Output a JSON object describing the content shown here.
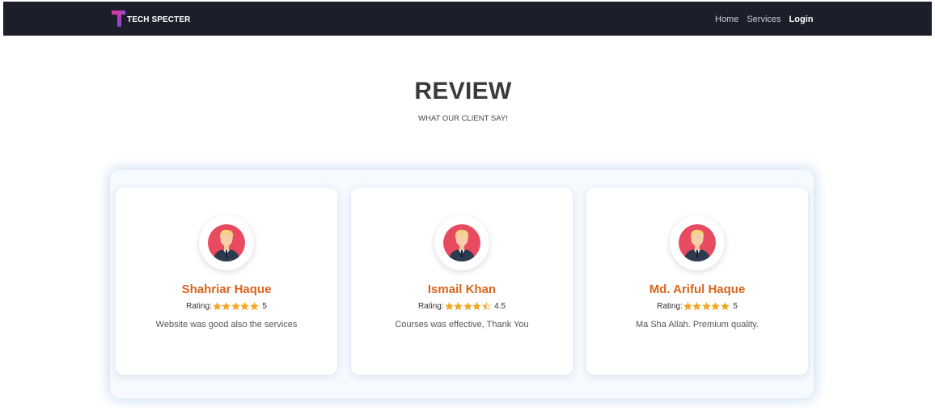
{
  "navbar": {
    "brand": "TECH SPECTER",
    "links": [
      {
        "label": "Home"
      },
      {
        "label": "Services"
      },
      {
        "label": "Login"
      }
    ]
  },
  "section": {
    "title": "REVIEW",
    "subtitle": "WHAT OUR CLIENT SAY!"
  },
  "reviews": [
    {
      "name": "Shahriar Haque",
      "rating_label": "Rating:",
      "rating": 5,
      "rating_text": "5",
      "text": "Website was good also the services"
    },
    {
      "name": "Ismail Khan",
      "rating_label": "Rating:",
      "rating": 4.5,
      "rating_text": "4.5",
      "text": "Courses was effective, Thank You"
    },
    {
      "name": "Md. Ariful Haque",
      "rating_label": "Rating:",
      "rating": 5,
      "rating_text": "5",
      "text": "Ma Sha Allah. Premium quality."
    }
  ],
  "icons": {
    "logo": "tech-specter-logo-icon",
    "avatar": "user-avatar-icon",
    "star": "star-icon"
  },
  "colors": {
    "navbar_bg": "#1c1f2b",
    "name": "#d9641e",
    "star": "#f5a623",
    "avatar_bg": "#e84a5f"
  }
}
